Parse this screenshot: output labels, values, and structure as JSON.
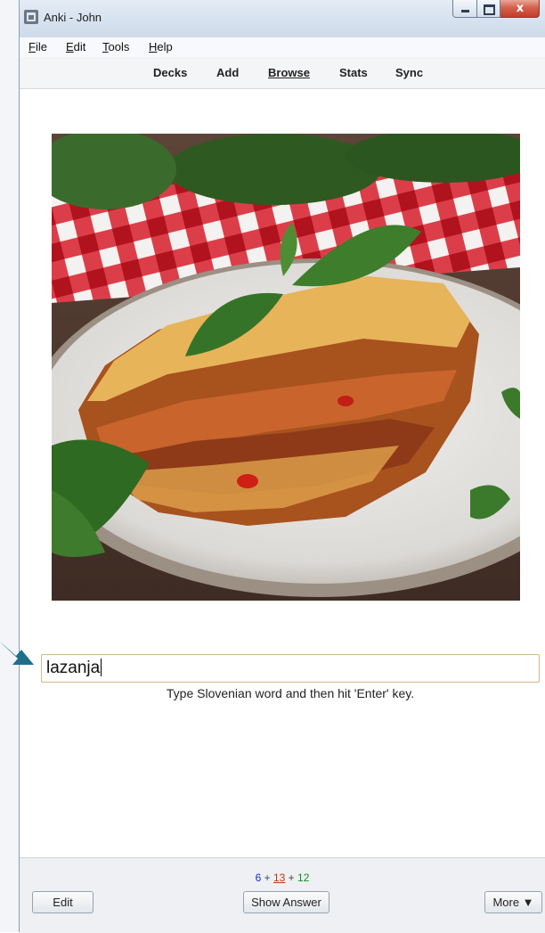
{
  "window": {
    "title": "Anki - John",
    "close_glyph": "x"
  },
  "menu": [
    {
      "key": "F",
      "rest": "ile"
    },
    {
      "key": "E",
      "rest": "dit"
    },
    {
      "key": "T",
      "rest": "ools"
    },
    {
      "key": "H",
      "rest": "elp"
    }
  ],
  "toolbar": {
    "decks": "Decks",
    "add": "Add",
    "browse": "Browse",
    "stats": "Stats",
    "sync": "Sync"
  },
  "card": {
    "image_subject": "lasagna on a white plate with basil, red checkered napkin",
    "answer_value": "lazanja",
    "hint": "Type Slovenian word and then hit 'Enter' key."
  },
  "counts": {
    "new": "6",
    "plus1": " + ",
    "learning": "13",
    "plus2": " + ",
    "review": "12"
  },
  "buttons": {
    "edit": "Edit",
    "show_answer": "Show Answer",
    "more": "More ▼"
  },
  "colors": {
    "new": "#1030d0",
    "learning": "#c03510",
    "review": "#10901a",
    "arrow": "#1f6f8b"
  }
}
